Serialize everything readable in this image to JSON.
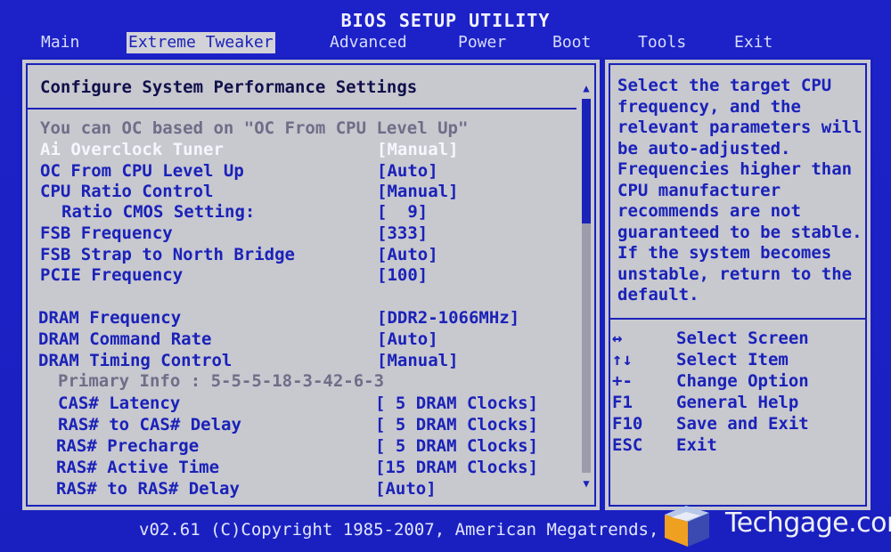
{
  "title": "BIOS SETUP UTILITY",
  "menu": [
    "Main",
    "Extreme Tweaker",
    "Advanced",
    "Power",
    "Boot",
    "Tools",
    "Exit"
  ],
  "active_menu": "Extreme Tweaker",
  "main": {
    "heading": "Configure System Performance Settings",
    "note": "You can OC based on \"OC From CPU Level Up\"",
    "settings": [
      {
        "label": "Ai Overclock Tuner",
        "value": "[Manual]"
      },
      {
        "label": "OC From CPU Level Up",
        "value": "[Auto]"
      },
      {
        "label": "CPU Ratio Control",
        "value": "[Manual]"
      },
      {
        "label": "Ratio CMOS Setting:",
        "value": "[  9]"
      },
      {
        "label": "FSB Frequency",
        "value": "[333]"
      },
      {
        "label": "FSB Strap to North Bridge",
        "value": "[Auto]"
      },
      {
        "label": "PCIE Frequency",
        "value": "[100]"
      },
      {
        "label": "DRAM Frequency",
        "value": "[DDR2-1066MHz]"
      },
      {
        "label": "DRAM Command Rate",
        "value": "[Auto]"
      },
      {
        "label": "DRAM Timing Control",
        "value": "[Manual]"
      },
      {
        "label": "Primary Info : 5-5-5-18-3-42-6-3"
      },
      {
        "label": "CAS# Latency",
        "value": "[ 5 DRAM Clocks]"
      },
      {
        "label": "RAS# to CAS# Delay",
        "value": "[ 5 DRAM Clocks]"
      },
      {
        "label": "RAS# Precharge",
        "value": "[ 5 DRAM Clocks]"
      },
      {
        "label": "RAS# Active Time",
        "value": "[15 DRAM Clocks]"
      },
      {
        "label": "RAS# to RAS# Delay",
        "value": "[Auto]"
      }
    ]
  },
  "help": {
    "text": "Select the target CPU frequency, and the relevant parameters will be auto-adjusted. Frequencies higher than CPU manufacturer recommends are not guaranteed to be stable. If the system becomes unstable, return to the default.",
    "keys": [
      {
        "key": "↔",
        "action": "Select Screen"
      },
      {
        "key": "↑↓",
        "action": "Select Item"
      },
      {
        "key": "+-",
        "action": "Change Option"
      },
      {
        "key": "F1",
        "action": "General Help"
      },
      {
        "key": "F10",
        "action": "Save and Exit"
      },
      {
        "key": "ESC",
        "action": "Exit"
      }
    ]
  },
  "footer": "v02.61 (C)Copyright 1985-2007, American Megatrends, Inc.",
  "watermark": "Techgage.com",
  "colors": {
    "background": "#1c22c8",
    "panel": "#c8c8cf",
    "text": "#1a22b8",
    "highlight": "#f6f6ff"
  }
}
